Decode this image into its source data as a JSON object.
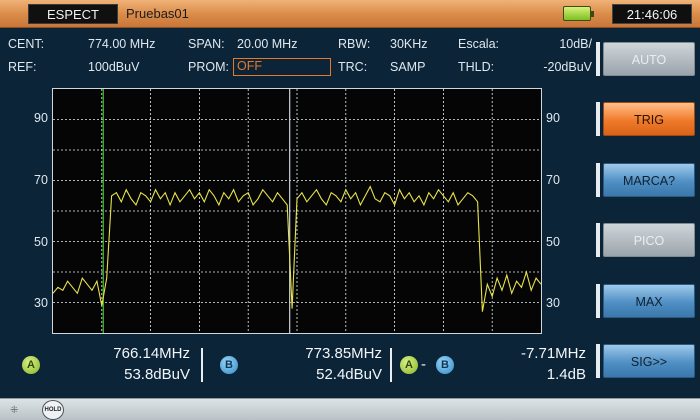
{
  "header": {
    "mode_tab": "ESPECT",
    "file_name": "Pruebas01",
    "battery_icon": "battery-icon",
    "clock": "21:46:06"
  },
  "settings": {
    "cent_label": "CENT:",
    "cent_value": "774.00 MHz",
    "span_label": "SPAN:",
    "span_value": "20.00  MHz",
    "rbw_label": "RBW:",
    "rbw_value": "30KHz",
    "escala_label": "Escala:",
    "escala_value": "10dB/",
    "ref_label": "REF:",
    "ref_value": "100dBuV",
    "prom_label": "PROM:",
    "prom_value": "OFF",
    "trc_label": "TRC:",
    "trc_value": "SAMP",
    "thld_label": "THLD:",
    "thld_value": "-20dBuV"
  },
  "chart_data": {
    "type": "line",
    "y_ticks": [
      "90",
      "70",
      "50",
      "30"
    ],
    "ylim": [
      20,
      100
    ],
    "x_divisions": 10,
    "grid": true,
    "series": [
      {
        "x": [
          0,
          1,
          2,
          3,
          4,
          5,
          6,
          7,
          8,
          9,
          10,
          11,
          12,
          13,
          14,
          15,
          16,
          17,
          18,
          19,
          20,
          21,
          22,
          23,
          24,
          25,
          26,
          27,
          28,
          29,
          30,
          31,
          32,
          33,
          34,
          35,
          36,
          37,
          38,
          39,
          40,
          41,
          42,
          43,
          44,
          45,
          46,
          47,
          48,
          49,
          50,
          51,
          52,
          53,
          54,
          55,
          56,
          57,
          58,
          59,
          60,
          61,
          62,
          63,
          64,
          65,
          66,
          67,
          68,
          69,
          70,
          71,
          72,
          73,
          74,
          75,
          76,
          77,
          78,
          79,
          80,
          81,
          82,
          83,
          84,
          85,
          86,
          87,
          88,
          89,
          90,
          91,
          92,
          93,
          94,
          95,
          96,
          97,
          98,
          99,
          100
        ],
        "values": [
          33,
          35,
          34,
          37,
          35,
          33,
          38,
          36,
          34,
          37,
          29,
          38,
          65,
          66,
          63,
          67,
          64,
          62,
          66,
          65,
          63,
          67,
          64,
          66,
          62,
          66,
          63,
          65,
          67,
          64,
          66,
          63,
          67,
          65,
          62,
          66,
          64,
          67,
          63,
          65,
          66,
          62,
          64,
          67,
          65,
          63,
          66,
          64,
          62,
          28,
          64,
          66,
          63,
          65,
          67,
          64,
          62,
          66,
          65,
          63,
          67,
          64,
          66,
          62,
          65,
          68,
          64,
          63,
          66,
          65,
          62,
          67,
          64,
          66,
          63,
          65,
          62,
          66,
          64,
          67,
          65,
          63,
          66,
          62,
          64,
          66,
          65,
          63,
          27,
          36,
          32,
          38,
          34,
          39,
          33,
          37,
          35,
          40,
          34,
          38,
          36
        ],
        "color": "#e8e24a"
      }
    ],
    "markers": [
      {
        "name": "A",
        "x": 10.3,
        "color": "#3fc62e"
      },
      {
        "name": "B",
        "x": 48.5,
        "color": "#c9d1d6"
      }
    ]
  },
  "readouts": {
    "a_badge": "A",
    "a_freq": "766.14MHz",
    "a_level": "53.8dBuV",
    "b_badge": "B",
    "b_freq": "773.85MHz",
    "b_level": "52.4dBuV",
    "delta_a": "A",
    "delta_minus": "-",
    "delta_b": "B",
    "delta_freq": "-7.71MHz",
    "delta_level": "1.4dB"
  },
  "softkeys": {
    "auto": "AUTO",
    "trig": "TRIG",
    "marca": "MARCA?",
    "pico": "PICO",
    "max": "MAX",
    "sig": "SIG>>"
  },
  "statusbar": {
    "grip_icon": "grip-icon",
    "hold_label": "HOLD"
  }
}
